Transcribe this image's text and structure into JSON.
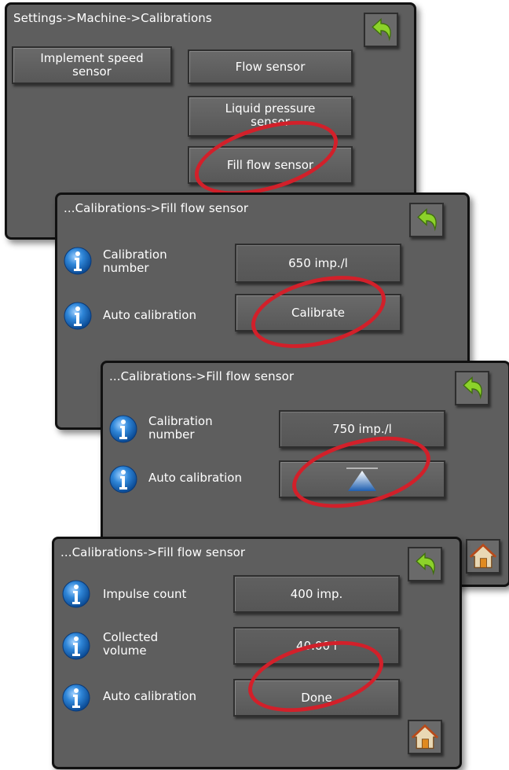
{
  "panel1": {
    "title": "Settings->Machine->Calibrations",
    "buttons": {
      "implement_speed": "Implement speed sensor",
      "flow_sensor": "Flow sensor",
      "liquid_pressure": "Liquid pressure sensor",
      "fill_flow": "Fill flow sensor"
    }
  },
  "panel2": {
    "title": "...Calibrations->Fill flow sensor",
    "rows": [
      {
        "label": "Calibration number",
        "value": "650 imp./l"
      },
      {
        "label": "Auto calibration",
        "value": "Calibrate"
      }
    ]
  },
  "panel3": {
    "title": "...Calibrations->Fill flow sensor",
    "rows": [
      {
        "label": "Calibration number",
        "value": "750 imp./l"
      },
      {
        "label": "Auto calibration",
        "value": ""
      }
    ]
  },
  "panel4": {
    "title": "...Calibrations->Fill flow sensor",
    "rows": [
      {
        "label": "Impulse count",
        "value": "400 imp."
      },
      {
        "label": "Collected volume",
        "value": "40.00 l"
      },
      {
        "label": "Auto calibration",
        "value": "Done"
      }
    ]
  },
  "icons": {
    "back": "back-arrow-icon",
    "home": "home-icon",
    "info": "info-icon",
    "progress": "progress-triangle-icon"
  },
  "colors": {
    "panel_bg": "#5e5e5e",
    "highlight_ring": "#d2202a",
    "back_arrow": "#8cd22a",
    "info_blue": "#1e73c8"
  }
}
